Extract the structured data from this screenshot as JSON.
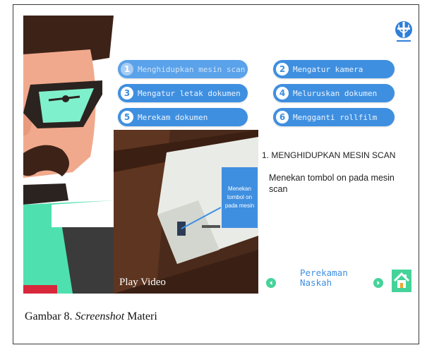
{
  "menu": {
    "items": [
      {
        "num": "1",
        "label": "Menghidupkan mesin scan",
        "active": true
      },
      {
        "num": "2",
        "label": "Mengatur kamera"
      },
      {
        "num": "3",
        "label": "Mengatur letak dokumen"
      },
      {
        "num": "4",
        "label": "Meluruskan dokumen"
      },
      {
        "num": "5",
        "label": "Merekam dokumen"
      },
      {
        "num": "6",
        "label": "Mengganti rollfilm"
      }
    ]
  },
  "video": {
    "caption_lines": [
      "Menekan",
      "tombol on",
      "pada mesin"
    ],
    "play_label": "Play Video"
  },
  "content": {
    "step_title": "1. MENGHIDUPKAN MESIN SCAN",
    "step_description": "Menekan tombol on pada mesin scan"
  },
  "navigation": {
    "label_line1": "Perekaman",
    "label_line2": "Naskah"
  },
  "icons": {
    "logo": "institution-logo-icon",
    "prev": "chevron-left-icon",
    "next": "chevron-right-icon",
    "home": "home-icon"
  },
  "colors": {
    "button_blue": "#3f8fe0",
    "nav_green": "#46d39a",
    "character_mint": "#4fe0b0",
    "character_skin": "#f1a98d"
  },
  "caption": {
    "prefix": "Gambar 8. ",
    "italic": "Screenshot",
    "suffix": " Materi"
  }
}
